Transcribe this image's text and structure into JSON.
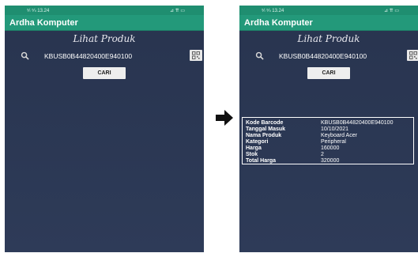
{
  "left_screen": {
    "status": {
      "left": "⁵⁄ₗ ⁵⁄ₗₗ 13.24",
      "right": "⊿ ⇈ ▭"
    },
    "app_title": "Ardha Komputer",
    "page_title": "Lihat Produk",
    "search": {
      "value": "KBUSB0B44820400E940100"
    },
    "cari_label": "CARI"
  },
  "right_screen": {
    "status": {
      "left": "⁵⁄ₗ ⁵⁄ₗₗ 13.24",
      "right": "⊿ ⇈ ▭"
    },
    "app_title": "Ardha Komputer",
    "page_title": "Lihat Produk",
    "search": {
      "value": "KBUSB0B44820400E940100"
    },
    "cari_label": "CARI",
    "result": [
      {
        "key": "Kode Barcode",
        "value": "KBUSB0B44820400E940100"
      },
      {
        "key": "Tanggal Masuk",
        "value": "10/10/2021"
      },
      {
        "key": "Nama Produk",
        "value": "Keyboard Acer"
      },
      {
        "key": "Kategori",
        "value": "Peripheral"
      },
      {
        "key": "Harga",
        "value": "160000"
      },
      {
        "key": "Stok",
        "value": "2"
      },
      {
        "key": "Total Harga",
        "value": "320000"
      }
    ]
  },
  "icons": {
    "search": "search-icon",
    "scan": "qr-scan-icon",
    "arrow": "right-arrow-icon"
  },
  "colors": {
    "appbar": "#23997a",
    "statusbar": "#1f8e70",
    "background": "#2b3754"
  }
}
